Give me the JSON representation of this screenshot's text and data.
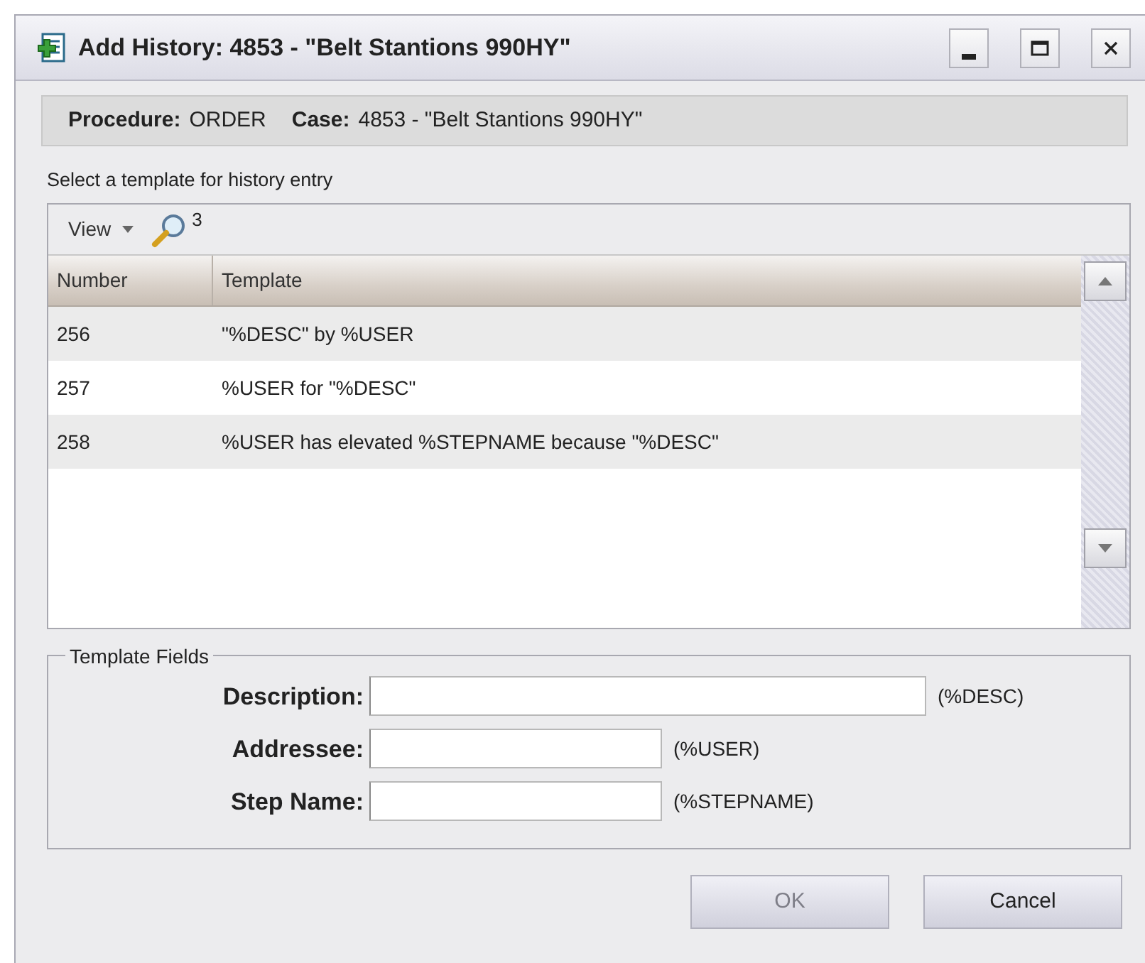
{
  "window": {
    "title": "Add History: 4853 - \"Belt Stantions 990HY\""
  },
  "info_bar": [
    {
      "label": "Procedure:",
      "value": "ORDER"
    },
    {
      "label": "Case:",
      "value": "4853 - \"Belt Stantions 990HY\""
    }
  ],
  "template_prompt": "Select a template for history entry",
  "toolbar": {
    "view_menu": "View",
    "count": "3"
  },
  "table": {
    "columns": [
      "Number",
      "Template"
    ],
    "rows": [
      {
        "number": "256",
        "template": "\"%DESC\" by %USER"
      },
      {
        "number": "257",
        "template": "%USER for \"%DESC\""
      },
      {
        "number": "258",
        "template": "%USER has elevated %STEPNAME because \"%DESC\""
      }
    ]
  },
  "template_fields": {
    "title": "Template Fields",
    "fields": [
      {
        "label": "Description:",
        "variable": "(%DESC)",
        "wide": true
      },
      {
        "label": "Addressee:",
        "variable": "(%USER)",
        "wide": false
      },
      {
        "label": "Step Name:",
        "variable": "(%STEPNAME)",
        "wide": false
      }
    ]
  },
  "buttons": [
    {
      "label": "OK",
      "disabled": true
    },
    {
      "label": "Cancel",
      "disabled": false
    }
  ]
}
